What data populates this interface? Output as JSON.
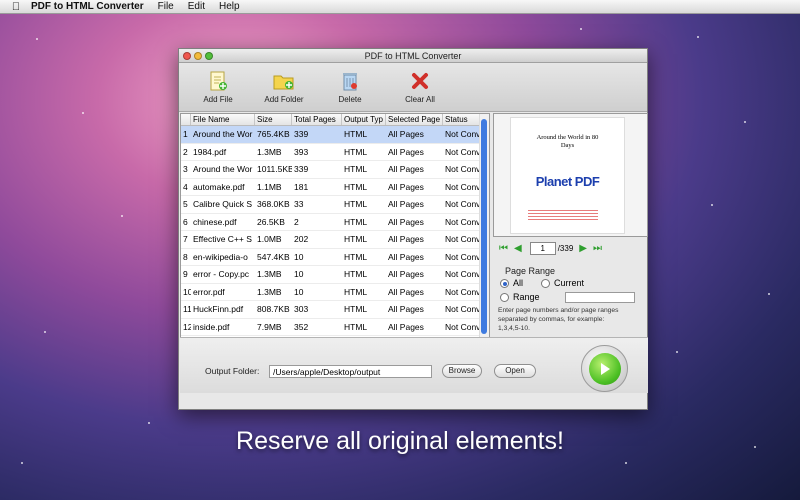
{
  "menubar": {
    "apple": "",
    "app_name": "PDF to HTML Converter",
    "items": [
      "File",
      "Edit",
      "Help"
    ]
  },
  "window": {
    "title": "PDF to HTML Converter",
    "toolbar": {
      "add_file": "Add File",
      "add_folder": "Add Folder",
      "delete": "Delete",
      "clear_all": "Clear All"
    },
    "table": {
      "headers": [
        "",
        "File Name",
        "Size",
        "Total Pages",
        "Output Typ",
        "Selected Page",
        "Status"
      ],
      "rows": [
        [
          "1",
          "Around the Wor",
          "765.4KB",
          "339",
          "HTML",
          "All Pages",
          "Not Conve"
        ],
        [
          "2",
          "1984.pdf",
          "1.3MB",
          "393",
          "HTML",
          "All Pages",
          "Not Conve"
        ],
        [
          "3",
          "Around the Wor",
          "1011.5KB",
          "339",
          "HTML",
          "All Pages",
          "Not Conve"
        ],
        [
          "4",
          "automake.pdf",
          "1.1MB",
          "181",
          "HTML",
          "All Pages",
          "Not Conve"
        ],
        [
          "5",
          "Calibre Quick S",
          "368.0KB",
          "33",
          "HTML",
          "All Pages",
          "Not Conve"
        ],
        [
          "6",
          "chinese.pdf",
          "26.5KB",
          "2",
          "HTML",
          "All Pages",
          "Not Conve"
        ],
        [
          "7",
          "Effective C++ S",
          "1.0MB",
          "202",
          "HTML",
          "All Pages",
          "Not Conve"
        ],
        [
          "8",
          "en-wikipedia-o",
          "547.4KB",
          "10",
          "HTML",
          "All Pages",
          "Not Conve"
        ],
        [
          "9",
          "error - Copy.pc",
          "1.3MB",
          "10",
          "HTML",
          "All Pages",
          "Not Conve"
        ],
        [
          "10",
          "error.pdf",
          "1.3MB",
          "10",
          "HTML",
          "All Pages",
          "Not Conve"
        ],
        [
          "11",
          "HuckFinn.pdf",
          "808.7KB",
          "303",
          "HTML",
          "All Pages",
          "Not Conve"
        ],
        [
          "12",
          "inside.pdf",
          "7.9MB",
          "352",
          "HTML",
          "All Pages",
          "Not Conve"
        ]
      ]
    },
    "preview": {
      "page_title_line1": "Around the World in 80",
      "page_title_line2": "Days",
      "logo_text": "Planet PDF",
      "current_page": "1",
      "total_pages": "/339"
    },
    "page_range": {
      "title": "Page Range",
      "all": "All",
      "current": "Current",
      "range": "Range",
      "help_line1": "Enter page numbers and/or page ranges",
      "help_line2": "separated by commas, for example:",
      "help_line3": "1,3,4,5-10."
    },
    "output": {
      "label": "Output Folder:",
      "path": "/Users/apple/Desktop/output",
      "browse": "Browse",
      "open": "Open"
    }
  },
  "caption": "Reserve all original elements!",
  "colors": {
    "accent": "#3f7be0",
    "selection": "#c3d7f7",
    "play_green": "#4bbf23"
  }
}
